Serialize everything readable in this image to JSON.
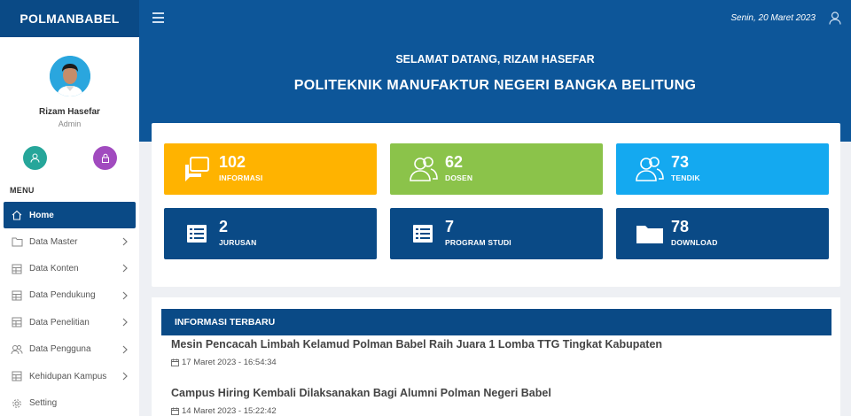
{
  "brand": "POLMANBABEL",
  "topbar": {
    "date": "Senin, 20 Maret 2023"
  },
  "user": {
    "name": "Rizam Hasefar",
    "role": "Admin"
  },
  "menu_title": "MENU",
  "nav": [
    {
      "label": "Home",
      "icon": "home-icon",
      "active": true
    },
    {
      "label": "Data Master",
      "icon": "folder-icon"
    },
    {
      "label": "Data Konten",
      "icon": "table-icon"
    },
    {
      "label": "Data Pendukung",
      "icon": "table-icon"
    },
    {
      "label": "Data Penelitian",
      "icon": "table-icon"
    },
    {
      "label": "Data Pengguna",
      "icon": "users-icon"
    },
    {
      "label": "Kehidupan Kampus",
      "icon": "table-icon"
    },
    {
      "label": "Setting",
      "icon": "gear-icon"
    }
  ],
  "hero": {
    "welcome": "SELAMAT DATANG, RIZAM HASEFAR",
    "institution": "POLITEKNIK MANUFAKTUR NEGERI BANGKA BELITUNG"
  },
  "stats": [
    {
      "value": "102",
      "label": "INFORMASI",
      "color": "#ffb300",
      "icon": "chat-icon"
    },
    {
      "value": "62",
      "label": "DOSEN",
      "color": "#8bc34a",
      "icon": "users-icon"
    },
    {
      "value": "73",
      "label": "TENDIK",
      "color": "#14a9f0",
      "icon": "users-icon"
    },
    {
      "value": "2",
      "label": "JURUSAN",
      "color": "#0a4a86",
      "icon": "list-icon"
    },
    {
      "value": "7",
      "label": "PROGRAM STUDI",
      "color": "#0a4a86",
      "icon": "list-icon"
    },
    {
      "value": "78",
      "label": "DOWNLOAD",
      "color": "#0a4a86",
      "icon": "folder-icon"
    }
  ],
  "info": {
    "header": "INFORMASI TERBARU",
    "items": [
      {
        "title": "Mesin Pencacah Limbah Kelamud Polman Babel Raih Juara 1 Lomba TTG Tingkat Kabupaten",
        "date": "17 Maret 2023 - 16:54:34"
      },
      {
        "title": "Campus Hiring Kembali Dilaksanakan Bagi Alumni Polman Negeri Babel",
        "date": "14 Maret 2023 - 15:22:42"
      }
    ]
  }
}
